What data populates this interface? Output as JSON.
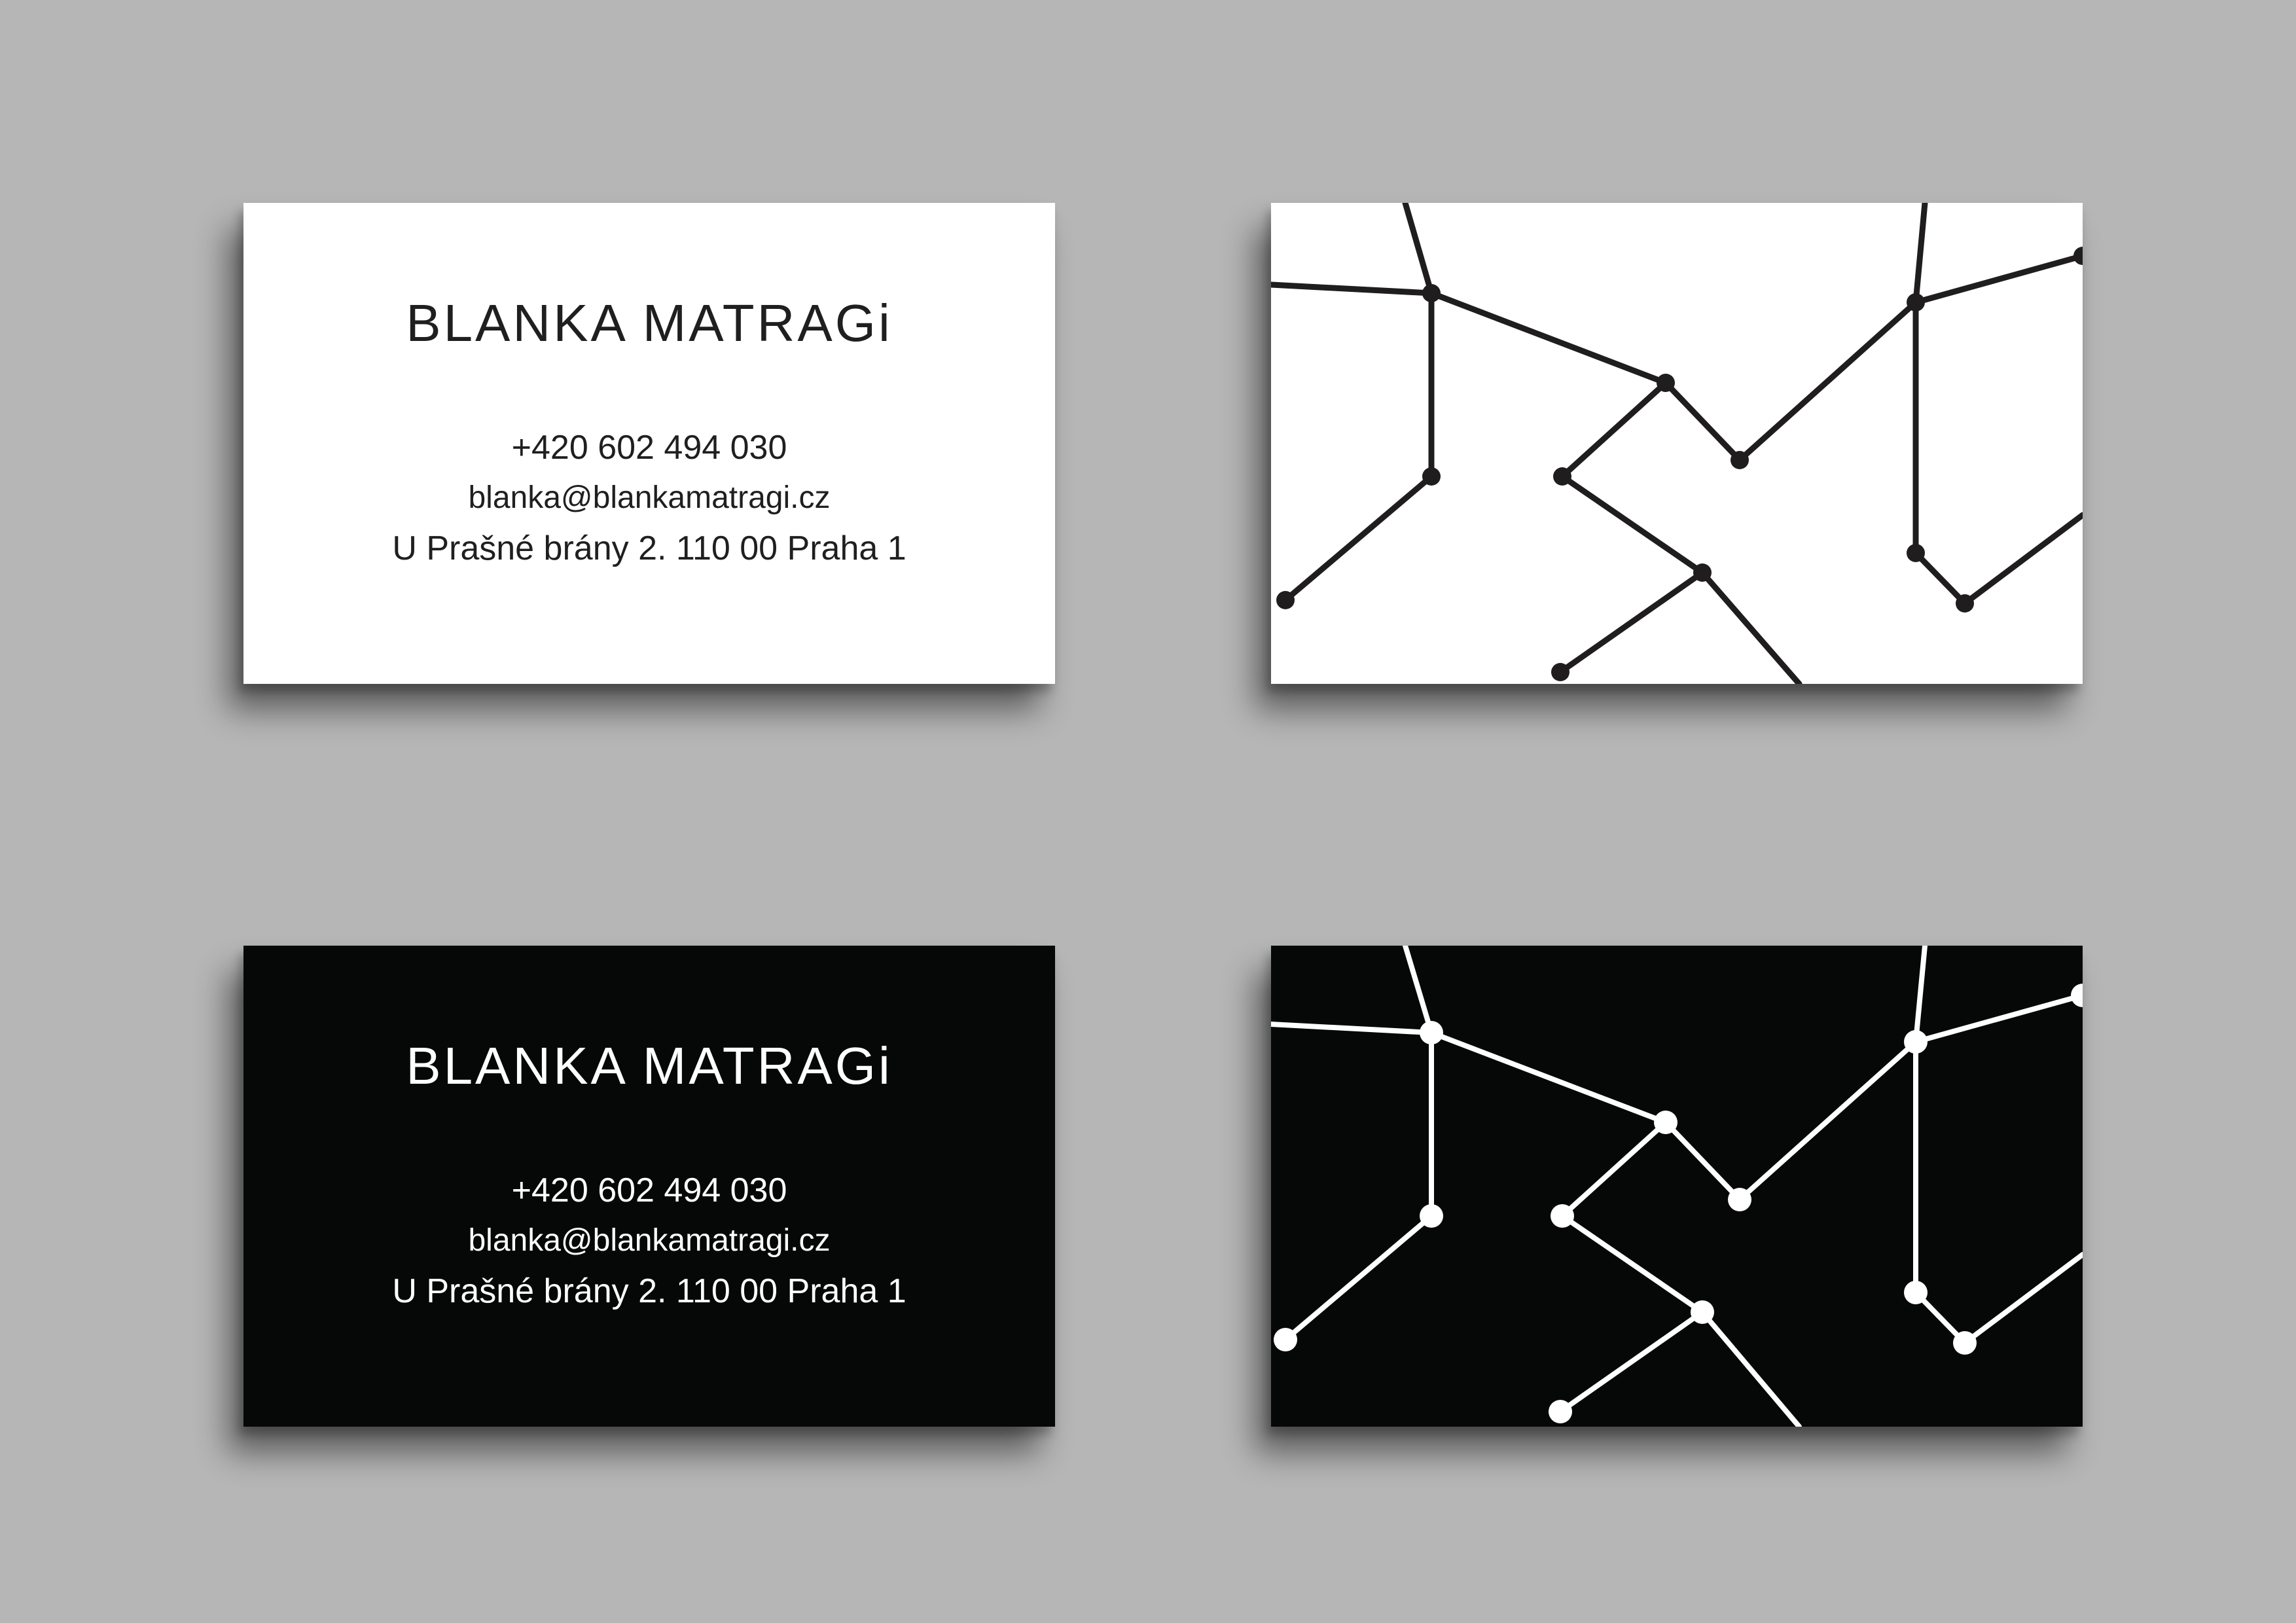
{
  "colors": {
    "background": "#b6b6b6",
    "card_light": "#ffffff",
    "card_dark": "#060808",
    "ink_dark": "#1f1f1f",
    "ink_light": "#ffffff"
  },
  "cards": {
    "front_light": {
      "name": "BLANKA MATRAGi",
      "phone": "+420 602 494 030",
      "email": "blanka@blankamatragi.cz",
      "address": "U Prašné brány 2. 110 00 Praha 1"
    },
    "front_dark": {
      "name": "BLANKA MATRAGi",
      "phone": "+420 602 494 030",
      "email": "blanka@blankamatragi.cz",
      "address": "U Prašné brány 2. 110 00 Praha 1"
    },
    "back_light": {
      "pattern_icon": "network-lines-pattern"
    },
    "back_dark": {
      "pattern_icon": "network-lines-pattern"
    }
  }
}
